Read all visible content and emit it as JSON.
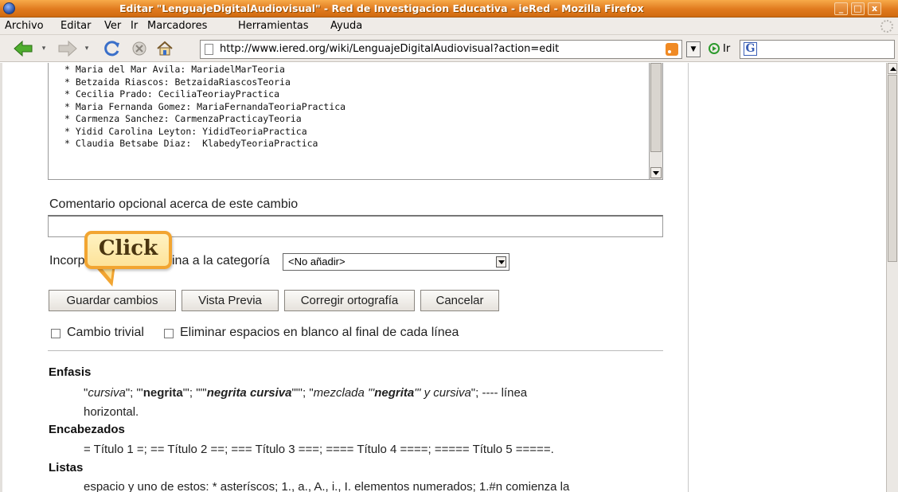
{
  "window": {
    "title": "Editar \"LenguajeDigitalAudiovisual\" - Red de Investigacion Educativa - ieRed - Mozilla Firefox",
    "buttons": [
      "_",
      "□",
      "x"
    ]
  },
  "menu": [
    "Archivo",
    "Editar",
    "Ver",
    "Ir",
    "Marcadores",
    "Herramientas",
    "Ayuda"
  ],
  "toolbar": {
    "url": "http://www.iered.org/wiki/LenguajeDigitalAudiovisual?action=edit",
    "go_label": "Ir",
    "search_engine_letter": "G"
  },
  "editor": {
    "lines": [
      "* Maria del Mar Avila: MariadelMarTeoria",
      "* Betzaida Riascos: BetzaidaRiascosTeoria",
      "* Cecilia Prado: CeciliaTeoriayPractica",
      "* Maria Fernanda Gomez: MariaFernandaTeoriaPractica",
      "* Carmenza Sanchez: CarmenzaPracticayTeoria",
      "* Yidid Carolina Leyton: YididTeoriaPractica",
      "* Claudia Betsabe Diaz:  KlabedyTeoriaPractica"
    ]
  },
  "form": {
    "summary_label": "Comentario opcional acerca de este cambio",
    "summary_value": "",
    "category_label_left": "Incorp",
    "category_label_right": "ina a la categoría",
    "category_selected": "<No añadir>",
    "buttons": {
      "save": "Guardar cambios",
      "preview": "Vista Previa",
      "spell": "Corregir ortografía",
      "cancel": "Cancelar"
    },
    "checkbox_minor": "Cambio trivial",
    "checkbox_trim": "Eliminar espacios en blanco al final de cada línea"
  },
  "help": {
    "enfasis_title": "Enfasis",
    "enfasis_parts": {
      "p1": "\"",
      "cursiva": "cursiva",
      "p2": "\"; \"'",
      "negrita": "negrita",
      "p3": "\"'; \"\"'",
      "negrita_cursiva": "negrita cursiva",
      "p4": "\"\"'; \"",
      "mezclada": "mezclada \"'",
      "negrita2": "negrita",
      "mezclada2": "\"' y cursiva",
      "p5": "\"; ---- línea"
    },
    "enfasis_line2": "horizontal.",
    "encabezados_title": "Encabezados",
    "encabezados_text": "= Título 1 =; == Título 2 ==; === Título 3 ===; ==== Título 4 ====; ===== Título 5 =====.",
    "listas_title": "Listas",
    "listas_text": "espacio y uno de estos: * asteríscos; 1., a., A., i., I. elementos numerados; 1.#n comienza la"
  },
  "callout": {
    "label": "Click"
  },
  "colors": {
    "titlebar": "#e07a1e",
    "callout_border": "#f2a531",
    "callout_fill": "#fde39a"
  }
}
